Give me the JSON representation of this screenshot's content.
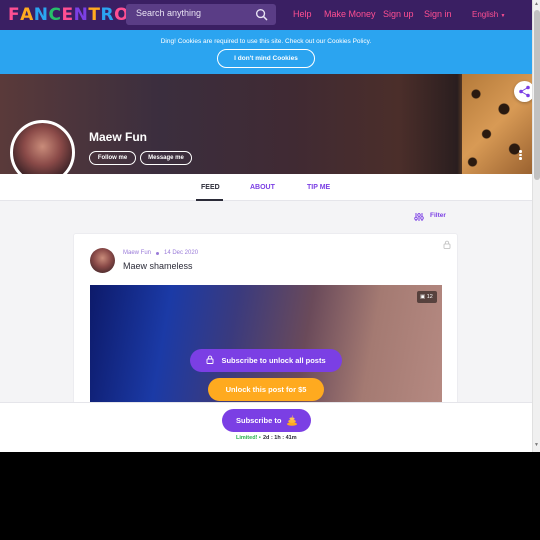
{
  "header": {
    "logo": "FANCENTRO",
    "logo_colors": [
      "#ff4f92",
      "#ffaa1f",
      "#2ba4f0",
      "#27c06a",
      "#ff4f92",
      "#7b3fe4",
      "#ffaa1f",
      "#2ba4f0",
      "#ff4f92"
    ],
    "search_placeholder": "Search anything",
    "links": [
      "Help",
      "Make Money",
      "Sign up",
      "Sign in"
    ],
    "language": "English"
  },
  "cookie_banner": {
    "message": "Ding! Cookies are required to use this site. Check out our Cookies Policy.",
    "button": "I don't mind Cookies"
  },
  "profile": {
    "name": "Maew Fun",
    "follow_button": "Follow me",
    "message_button": "Message me"
  },
  "tabs": [
    "FEED",
    "ABOUT",
    "TIP ME"
  ],
  "active_tab": "FEED",
  "filter_label": "Filter",
  "post": {
    "author": "Maew Fun",
    "date": "14 Dec 2020",
    "title": "Maew shameless",
    "media_count": "12",
    "subscribe_all_button": "Subscribe to unlock all posts",
    "unlock_button": "Unlock this post for $5"
  },
  "subscribe_bar": {
    "button": "Subscribe to",
    "limited_label": "Limited! •",
    "countdown": "2d : 1h : 41m"
  },
  "colors": {
    "brand_purple": "#7b3fe4",
    "pink": "#ff4f92",
    "orange": "#ffaa1f",
    "cookie_blue": "#2ba4f0",
    "nav_bg": "#3a1f63"
  }
}
